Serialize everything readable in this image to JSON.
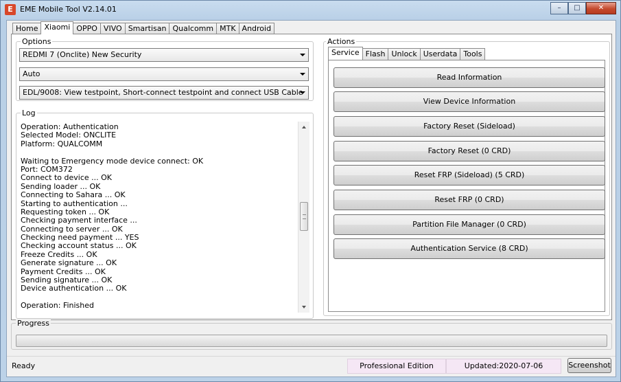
{
  "window": {
    "title": "EME Mobile Tool V2.14.01",
    "app_icon_letter": "E",
    "minimize_glyph": "–",
    "maximize_glyph": "□",
    "close_glyph": "✕"
  },
  "main_tabs": [
    "Home",
    "Xiaomi",
    "OPPO",
    "VIVO",
    "Smartisan",
    "Qualcomm",
    "MTK",
    "Android"
  ],
  "main_tab_active": "Xiaomi",
  "options": {
    "title": "Options",
    "model_select": "REDMI 7 (Onclite) New Security",
    "mode_select": "Auto",
    "method_select": "EDL/9008: View testpoint, Short-connect testpoint and connect USB Cable"
  },
  "log": {
    "title": "Log",
    "lines": [
      "Operation: Authentication",
      "Selected Model: ONCLITE",
      "Platform: QUALCOMM",
      "",
      "Waiting to Emergency mode device connect: OK",
      "Port: COM372",
      "Connect to device ... OK",
      "Sending loader ... OK",
      "Connecting to Sahara ... OK",
      "Starting to authentication ...",
      "Requesting token ... OK",
      "Checking payment interface ...",
      "Connecting to server ... OK",
      "Checking need payment ... YES",
      "Checking account status ... OK",
      "Freeze Credits ... OK",
      "Generate signature ... OK",
      "Payment Credits ... OK",
      "Sending signature ... OK",
      "Device authentication ... OK",
      "",
      "Operation: Finished"
    ]
  },
  "actions": {
    "title": "Actions",
    "tabs": [
      "Service",
      "Flash",
      "Unlock",
      "Userdata",
      "Tools"
    ],
    "active_tab": "Service",
    "buttons": [
      "Read Information",
      "View Device Information",
      "Factory Reset (Sideload)",
      "Factory Reset (0 CRD)",
      "Reset FRP (Sideload) (5 CRD)",
      "Reset FRP (0 CRD)",
      "Partition File Manager (0 CRD)",
      "Authentication Service (8 CRD)"
    ]
  },
  "progress": {
    "title": "Progress",
    "value_percent": 0
  },
  "status": {
    "ready": "Ready",
    "edition": "Professional Edition",
    "updated": "Updated:2020-07-06",
    "screenshot_button": "Screenshot"
  }
}
